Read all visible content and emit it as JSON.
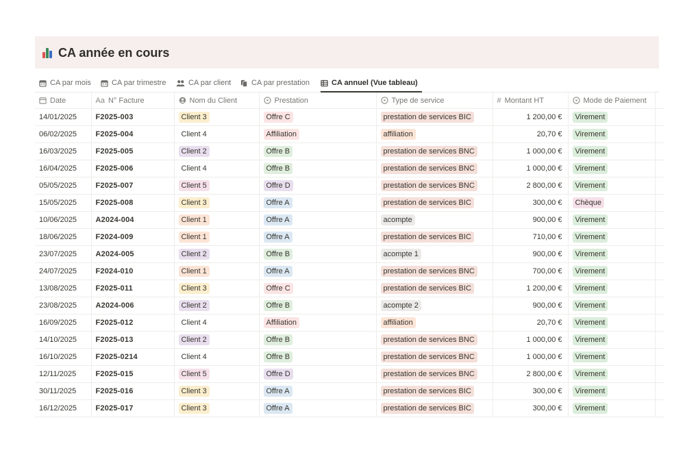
{
  "page": {
    "title": "CA année en cours",
    "icon": "bar-chart-icon"
  },
  "tabs": [
    {
      "label": "CA par mois",
      "icon": "calendar-icon",
      "active": false
    },
    {
      "label": "CA par trimestre",
      "icon": "calendar-icon",
      "active": false
    },
    {
      "label": "CA par client",
      "icon": "people-icon",
      "active": false
    },
    {
      "label": "CA par prestation",
      "icon": "copy-icon",
      "active": false
    },
    {
      "label": "CA annuel (Vue tableau)",
      "icon": "table-icon",
      "active": true
    }
  ],
  "columns": [
    {
      "label": "Date",
      "icon": "calendar-icon"
    },
    {
      "label": "N° Facture",
      "icon": "text-icon",
      "prefix": "Aa"
    },
    {
      "label": "Nom du Client",
      "icon": "person-icon"
    },
    {
      "label": "Prestation",
      "icon": "select-icon"
    },
    {
      "label": "Type de service",
      "icon": "select-icon"
    },
    {
      "label": "Montant HT",
      "icon": "number-icon",
      "prefix": "#"
    },
    {
      "label": "Mode de Paiement",
      "icon": "select-icon"
    }
  ],
  "tag_colors": {
    "Client 1": "#fbe4d6",
    "Client 2": "#e8deee",
    "Client 3": "#fbeecd",
    "Client 4": "#ffffff",
    "Client 5": "#f5e0e9",
    "Offre A": "#dbe8f3",
    "Offre B": "#dfeedd",
    "Offre C": "#fbe4e4",
    "Offre D": "#e8deee",
    "Affiliation": "#fbe4e4",
    "prestation de services BIC": "#f4dfd9",
    "prestation de services BNC": "#f4dfd9",
    "affiliation": "#fbe4d6",
    "acompte": "#ebeae8",
    "acompte 1": "#ebeae8",
    "acompte 2": "#ebeae8",
    "Virement": "#dbeddb",
    "Chèque": "#f5e0e9"
  },
  "rows": [
    {
      "date": "14/01/2025",
      "invoice": "F2025-003",
      "client": "Client 3",
      "prestation": "Offre C",
      "type": "prestation de services BIC",
      "amount": "1 200,00 €",
      "payment": "Virement"
    },
    {
      "date": "06/02/2025",
      "invoice": "F2025-004",
      "client": "Client 4",
      "prestation": "Affiliation",
      "type": "affiliation",
      "amount": "20,70 €",
      "payment": "Virement"
    },
    {
      "date": "16/03/2025",
      "invoice": "F2025-005",
      "client": "Client 2",
      "prestation": "Offre B",
      "type": "prestation de services BNC",
      "amount": "1 000,00 €",
      "payment": "Virement"
    },
    {
      "date": "16/04/2025",
      "invoice": "F2025-006",
      "client": "Client 4",
      "prestation": "Offre B",
      "type": "prestation de services BNC",
      "amount": "1 000,00 €",
      "payment": "Virement"
    },
    {
      "date": "05/05/2025",
      "invoice": "F2025-007",
      "client": "Client 5",
      "prestation": "Offre D",
      "type": "prestation de services BNC",
      "amount": "2 800,00 €",
      "payment": "Virement"
    },
    {
      "date": "15/05/2025",
      "invoice": "F2025-008",
      "client": "Client 3",
      "prestation": "Offre A",
      "type": "prestation de services BIC",
      "amount": "300,00 €",
      "payment": "Chèque"
    },
    {
      "date": "10/06/2025",
      "invoice": "A2024-004",
      "client": "Client 1",
      "prestation": "Offre A",
      "type": "acompte",
      "amount": "900,00 €",
      "payment": "Virement"
    },
    {
      "date": "18/06/2025",
      "invoice": "F2024-009",
      "client": "Client 1",
      "prestation": "Offre A",
      "type": "prestation de services BIC",
      "amount": "710,00 €",
      "payment": "Virement"
    },
    {
      "date": "23/07/2025",
      "invoice": "A2024-005",
      "client": "Client 2",
      "prestation": "Offre B",
      "type": "acompte 1",
      "amount": "900,00 €",
      "payment": "Virement"
    },
    {
      "date": "24/07/2025",
      "invoice": "F2024-010",
      "client": "Client 1",
      "prestation": "Offre A",
      "type": "prestation de services BNC",
      "amount": "700,00 €",
      "payment": "Virement"
    },
    {
      "date": "13/08/2025",
      "invoice": "F2025-011",
      "client": "Client 3",
      "prestation": "Offre C",
      "type": "prestation de services BIC",
      "amount": "1 200,00 €",
      "payment": "Virement"
    },
    {
      "date": "23/08/2025",
      "invoice": "A2024-006",
      "client": "Client 2",
      "prestation": "Offre B",
      "type": "acompte 2",
      "amount": "900,00 €",
      "payment": "Virement"
    },
    {
      "date": "16/09/2025",
      "invoice": "F2025-012",
      "client": "Client 4",
      "prestation": "Affiliation",
      "type": "affiliation",
      "amount": "20,70 €",
      "payment": "Virement"
    },
    {
      "date": "14/10/2025",
      "invoice": "F2025-013",
      "client": "Client 2",
      "prestation": "Offre B",
      "type": "prestation de services BNC",
      "amount": "1 000,00 €",
      "payment": "Virement"
    },
    {
      "date": "16/10/2025",
      "invoice": "F2025-0214",
      "client": "Client 4",
      "prestation": "Offre B",
      "type": "prestation de services BNC",
      "amount": "1 000,00 €",
      "payment": "Virement"
    },
    {
      "date": "12/11/2025",
      "invoice": "F2025-015",
      "client": "Client 5",
      "prestation": "Offre D",
      "type": "prestation de services BNC",
      "amount": "2 800,00 €",
      "payment": "Virement"
    },
    {
      "date": "30/11/2025",
      "invoice": "F2025-016",
      "client": "Client 3",
      "prestation": "Offre A",
      "type": "prestation de services BIC",
      "amount": "300,00 €",
      "payment": "Virement"
    },
    {
      "date": "16/12/2025",
      "invoice": "F2025-017",
      "client": "Client 3",
      "prestation": "Offre A",
      "type": "prestation de services BIC",
      "amount": "300,00 €",
      "payment": "Virement"
    }
  ]
}
